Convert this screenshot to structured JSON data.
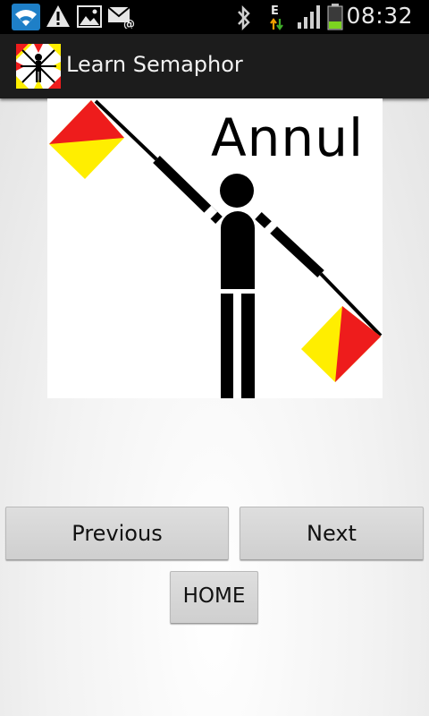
{
  "status_bar": {
    "time": "08:32",
    "icons": [
      "wifi-icon",
      "warning-icon",
      "image-icon",
      "email-icon",
      "bluetooth-icon",
      "data-e-icon",
      "signal-icon",
      "battery-icon"
    ],
    "network_type": "E"
  },
  "action_bar": {
    "title": "Learn Semaphor",
    "app_icon": "semaphore-app-icon"
  },
  "content": {
    "sign_word": "Annul",
    "flag_colors": {
      "red": "#ee1c1c",
      "yellow": "#ffee00"
    }
  },
  "buttons": {
    "previous": "Previous",
    "next": "Next",
    "home": "HOME"
  }
}
